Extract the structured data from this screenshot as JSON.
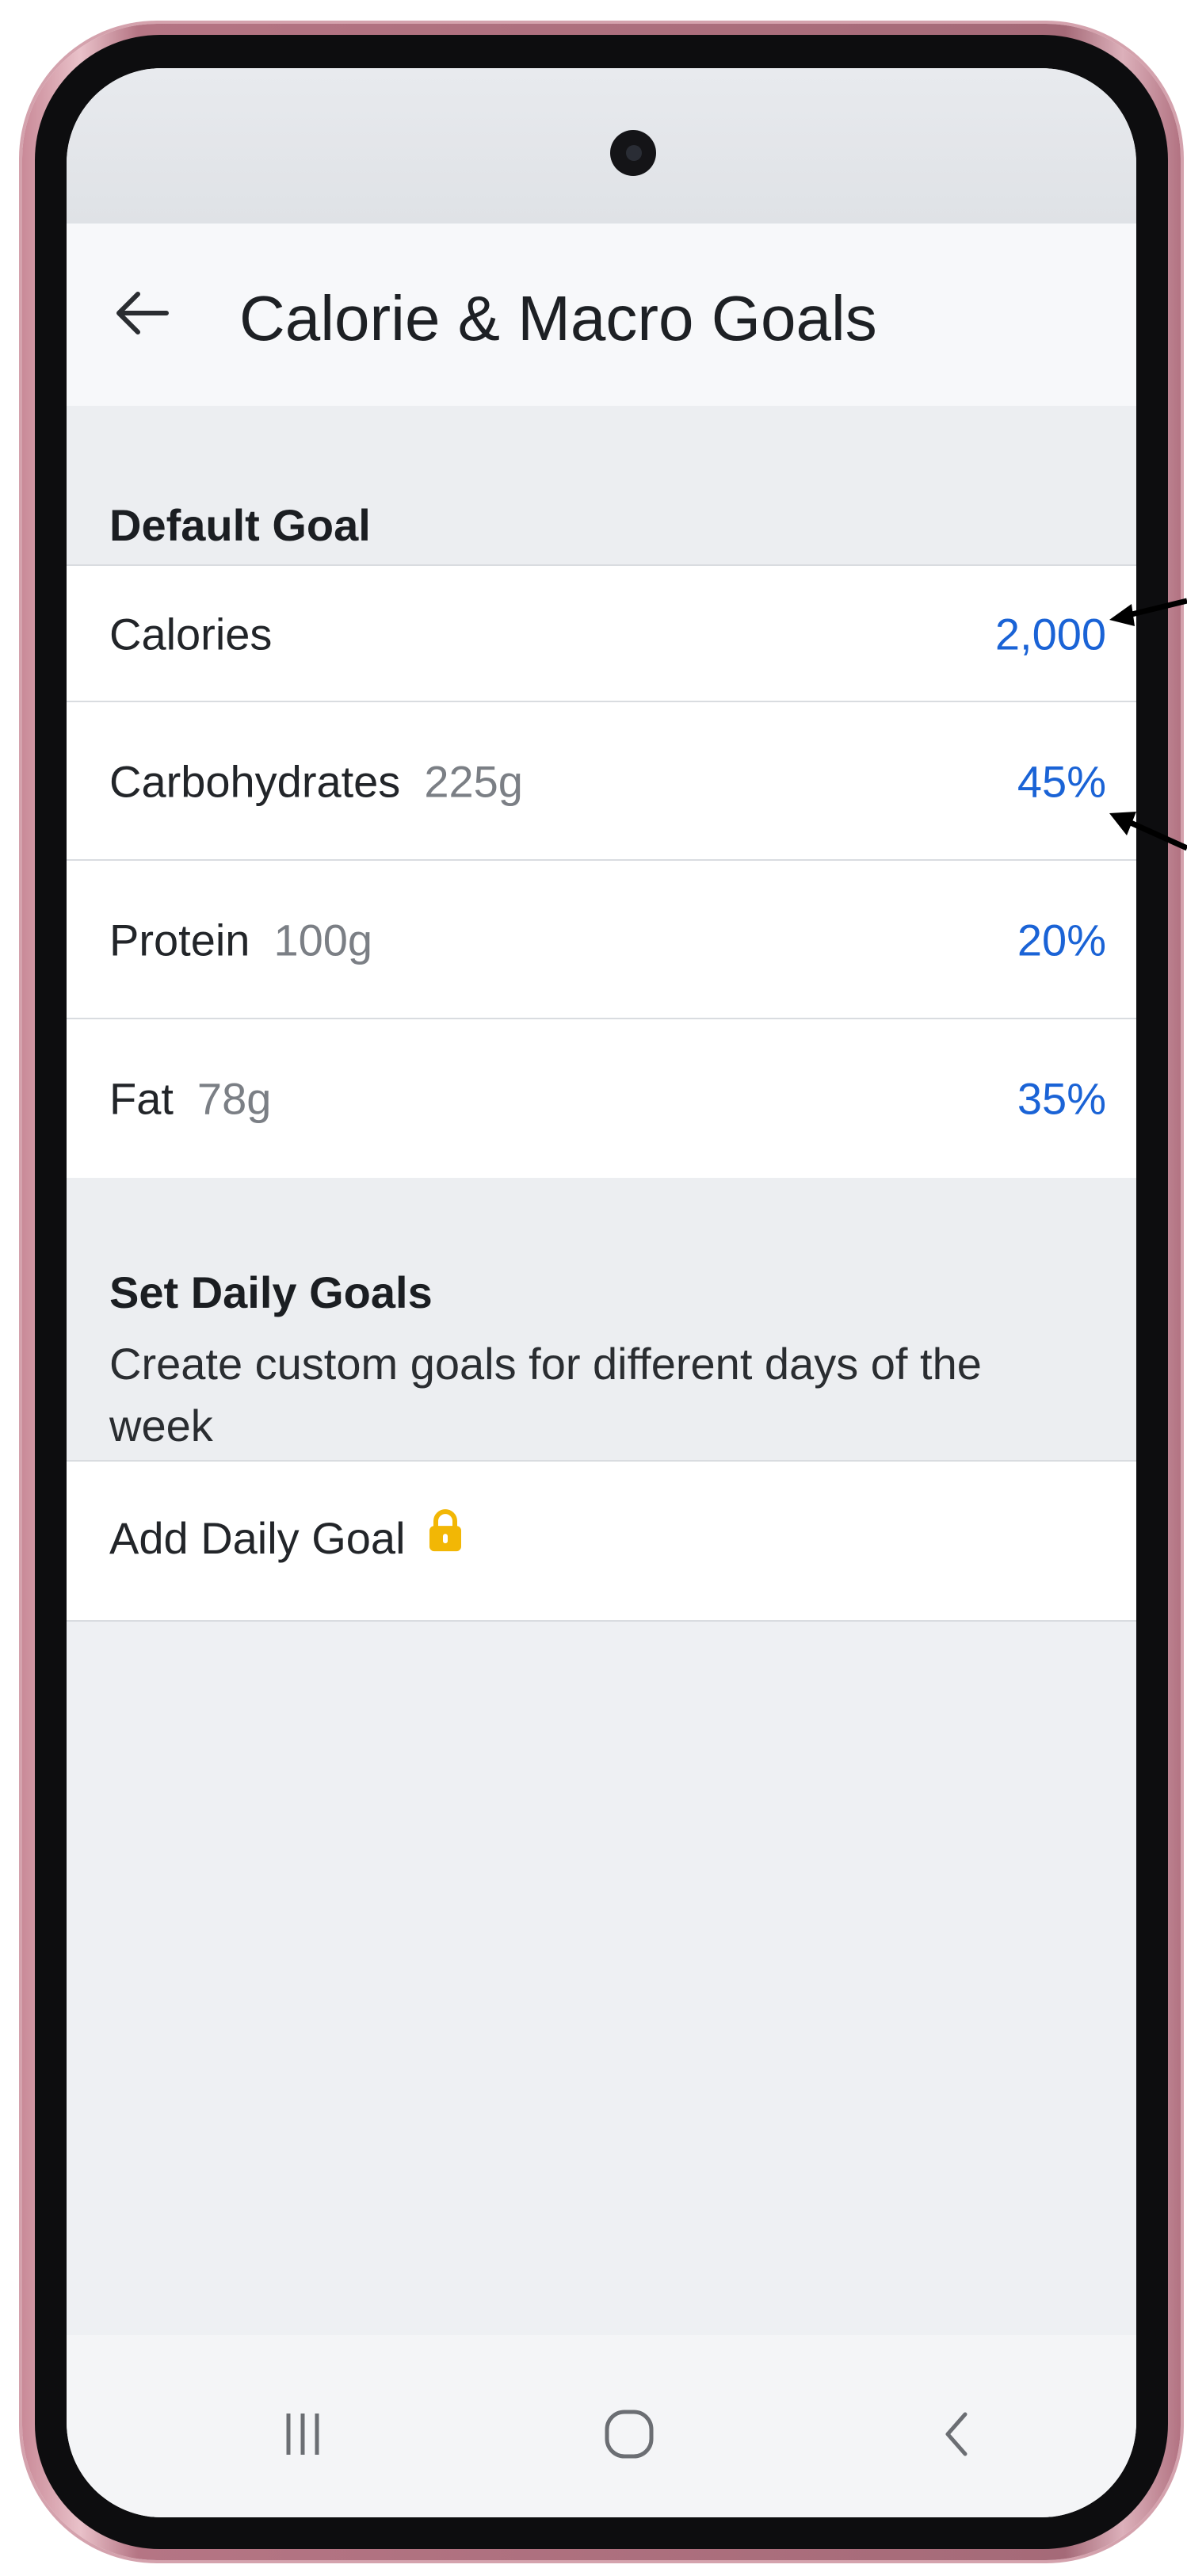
{
  "app": {
    "title": "Calorie & Macro Goals"
  },
  "default_goal": {
    "header": "Default Goal",
    "rows": [
      {
        "label": "Calories",
        "grams": "",
        "value": "2,000"
      },
      {
        "label": "Carbohydrates",
        "grams": "225g",
        "value": "45%"
      },
      {
        "label": "Protein",
        "grams": "100g",
        "value": "20%"
      },
      {
        "label": "Fat",
        "grams": "78g",
        "value": "35%"
      }
    ]
  },
  "daily_goals": {
    "header": "Set Daily Goals",
    "subtitle": "Create custom goals for different days of the week",
    "add_label": "Add Daily Goal"
  },
  "icons": {
    "back": "back-arrow-icon",
    "lock": "lock-icon",
    "recents": "recent-apps-icon",
    "home": "home-icon",
    "nav_back": "nav-back-icon"
  },
  "colors": {
    "accent": "#1a63d6",
    "lock": "#f2b705",
    "muted": "#7b7f85"
  }
}
